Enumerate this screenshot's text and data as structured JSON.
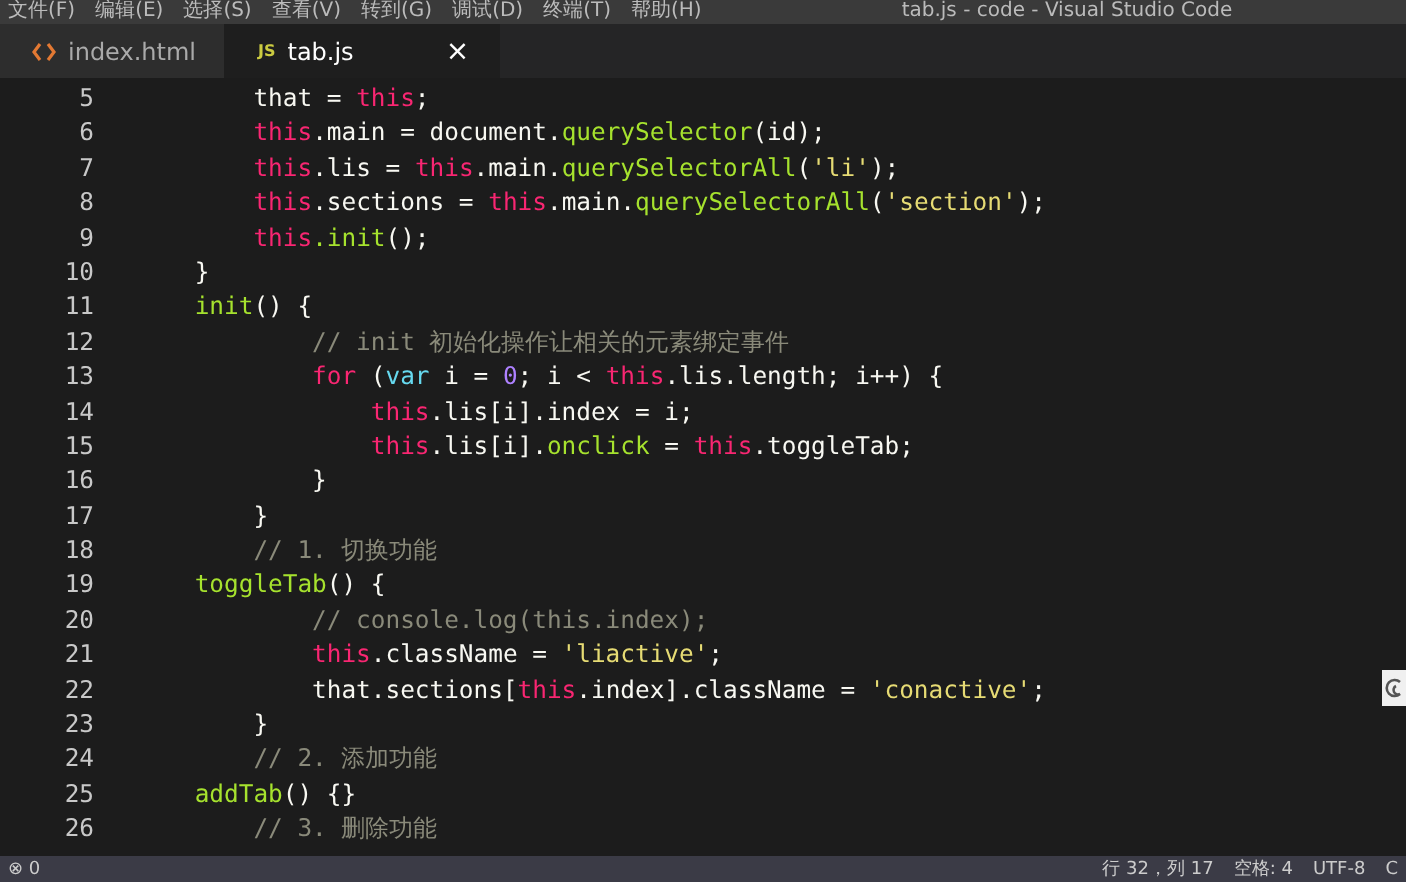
{
  "menu": [
    "文件(F)",
    "编辑(E)",
    "选择(S)",
    "查看(V)",
    "转到(G)",
    "调试(D)",
    "终端(T)",
    "帮助(H)"
  ],
  "window": {
    "title": "tab.js - code - Visual Studio Code"
  },
  "tabs": [
    {
      "label": "index.html",
      "kind": "html",
      "selected": false
    },
    {
      "label": "tab.js",
      "kind": "js",
      "badge": "JS",
      "close": "×",
      "selected": true
    }
  ],
  "code": [
    {
      "n": "5",
      "tokens": [
        {
          "kind": "plain",
          "text": "        that = "
        },
        {
          "kind": "keyword",
          "text": "this"
        },
        {
          "kind": "plain",
          "text": ";"
        }
      ]
    },
    {
      "n": "6",
      "tokens": [
        {
          "kind": "keyword",
          "text": "        this"
        },
        {
          "kind": "plain",
          "text": ".main = document."
        },
        {
          "kind": "function",
          "text": "querySelector"
        },
        {
          "kind": "plain",
          "text": "(id);"
        }
      ]
    },
    {
      "n": "7",
      "tokens": [
        {
          "kind": "keyword",
          "text": "        this"
        },
        {
          "kind": "plain",
          "text": ".lis = "
        },
        {
          "kind": "keyword",
          "text": "this"
        },
        {
          "kind": "plain",
          "text": ".main."
        },
        {
          "kind": "function",
          "text": "querySelectorAll"
        },
        {
          "kind": "plain",
          "text": "("
        },
        {
          "kind": "string",
          "text": "'li'"
        },
        {
          "kind": "plain",
          "text": ");"
        }
      ]
    },
    {
      "n": "8",
      "tokens": [
        {
          "kind": "keyword",
          "text": "        this"
        },
        {
          "kind": "plain",
          "text": ".sections = "
        },
        {
          "kind": "keyword",
          "text": "this"
        },
        {
          "kind": "plain",
          "text": ".main."
        },
        {
          "kind": "function",
          "text": "querySelectorAll"
        },
        {
          "kind": "plain",
          "text": "("
        },
        {
          "kind": "string",
          "text": "'section'"
        },
        {
          "kind": "plain",
          "text": ");"
        }
      ]
    },
    {
      "n": "9",
      "tokens": [
        {
          "kind": "keyword",
          "text": "        this"
        },
        {
          "kind": "function",
          "text": ".init"
        },
        {
          "kind": "plain",
          "text": "();"
        }
      ]
    },
    {
      "n": "10",
      "tokens": [
        {
          "kind": "plain",
          "text": "    }"
        }
      ]
    },
    {
      "n": "11",
      "tokens": [
        {
          "kind": "function",
          "text": "    init"
        },
        {
          "kind": "plain",
          "text": "() {"
        }
      ]
    },
    {
      "n": "12",
      "tokens": [
        {
          "kind": "comment",
          "text": "            // init 初始化操作让相关的元素绑定事件"
        }
      ]
    },
    {
      "n": "13",
      "tokens": [
        {
          "kind": "keyword",
          "text": "            for"
        },
        {
          "kind": "plain",
          "text": " ("
        },
        {
          "kind": "storage",
          "text": "var"
        },
        {
          "kind": "plain",
          "text": " i = "
        },
        {
          "kind": "number",
          "text": "0"
        },
        {
          "kind": "plain",
          "text": "; i < "
        },
        {
          "kind": "keyword",
          "text": "this"
        },
        {
          "kind": "plain",
          "text": ".lis.length; i++) {"
        }
      ]
    },
    {
      "n": "14",
      "tokens": [
        {
          "kind": "keyword",
          "text": "                this"
        },
        {
          "kind": "plain",
          "text": ".lis[i].index = i;"
        }
      ]
    },
    {
      "n": "15",
      "tokens": [
        {
          "kind": "keyword",
          "text": "                this"
        },
        {
          "kind": "plain",
          "text": ".lis[i]."
        },
        {
          "kind": "function",
          "text": "onclick"
        },
        {
          "kind": "plain",
          "text": " = "
        },
        {
          "kind": "keyword",
          "text": "this"
        },
        {
          "kind": "plain",
          "text": ".toggleTab;"
        }
      ]
    },
    {
      "n": "16",
      "tokens": [
        {
          "kind": "plain",
          "text": "            }"
        }
      ]
    },
    {
      "n": "17",
      "tokens": [
        {
          "kind": "plain",
          "text": "        }"
        }
      ]
    },
    {
      "n": "18",
      "tokens": [
        {
          "kind": "comment",
          "text": "        // 1. 切换功能"
        }
      ]
    },
    {
      "n": "19",
      "tokens": [
        {
          "kind": "function",
          "text": "    toggleTab"
        },
        {
          "kind": "plain",
          "text": "() {"
        }
      ]
    },
    {
      "n": "20",
      "tokens": [
        {
          "kind": "comment",
          "text": "            // console.log(this.index);"
        }
      ]
    },
    {
      "n": "21",
      "tokens": [
        {
          "kind": "keyword",
          "text": "            this"
        },
        {
          "kind": "plain",
          "text": ".className = "
        },
        {
          "kind": "string",
          "text": "'liactive'"
        },
        {
          "kind": "plain",
          "text": ";"
        }
      ]
    },
    {
      "n": "22",
      "tokens": [
        {
          "kind": "plain",
          "text": "            that.sections["
        },
        {
          "kind": "keyword",
          "text": "this"
        },
        {
          "kind": "plain",
          "text": ".index].className = "
        },
        {
          "kind": "string",
          "text": "'conactive'"
        },
        {
          "kind": "plain",
          "text": ";"
        }
      ]
    },
    {
      "n": "23",
      "tokens": [
        {
          "kind": "plain",
          "text": "        }"
        }
      ]
    },
    {
      "n": "24",
      "tokens": [
        {
          "kind": "comment",
          "text": "        // 2. 添加功能"
        }
      ]
    },
    {
      "n": "25",
      "tokens": [
        {
          "kind": "function",
          "text": "    addTab"
        },
        {
          "kind": "plain",
          "text": "() {}"
        }
      ]
    },
    {
      "n": "26",
      "tokens": [
        {
          "kind": "comment",
          "text": "        // 3. 删除功能"
        }
      ]
    }
  ],
  "status_bar": {
    "errors": "⊗ 0",
    "position": "行 32，列 17",
    "indent": "空格: 4",
    "encoding": "UTF-8",
    "language": "C"
  }
}
